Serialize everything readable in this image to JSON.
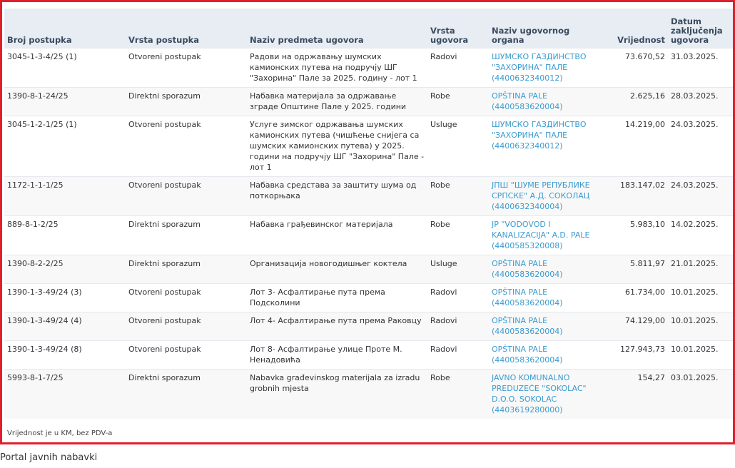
{
  "table": {
    "headers": {
      "broj": "Broj postupka",
      "vrsta_postupka": "Vrsta postupka",
      "naziv": "Naziv predmeta ugovora",
      "vrsta_ugovora": "Vrsta ugovora",
      "organ": "Naziv ugovornog organa",
      "vrijednost": "Vrijednost",
      "datum": "Datum zaključenja ugovora"
    },
    "rows": [
      {
        "broj": "3045-1-3-4/25 (1)",
        "vrsta_postupka": "Otvoreni postupak",
        "naziv": "Радови на одржавању шумских камионских путева на подручју ШГ \"Захорина\" Пале за 2025. годину - лот 1",
        "vrsta_ugovora": "Radovi",
        "organ": "ШУМСКО ГАЗДИНСТВО \"ЗАХОРИНА\" ПАЛЕ (4400632340012)",
        "vrijednost": "73.670,52",
        "datum": "31.03.2025."
      },
      {
        "broj": "1390-8-1-24/25",
        "vrsta_postupka": "Direktni sporazum",
        "naziv": "Набавка материјала за одржавање зграде Општине Пале у 2025. години",
        "vrsta_ugovora": "Robe",
        "organ": "OPŠTINA PALE (4400583620004)",
        "vrijednost": "2.625,16",
        "datum": "28.03.2025."
      },
      {
        "broj": "3045-1-2-1/25 (1)",
        "vrsta_postupka": "Otvoreni postupak",
        "naziv": "Услуге зимског одржавања шумских камионских путева (чишћење снијега са шумских камионских путева) у 2025. години на подручју ШГ \"Захорина\" Пале - лот 1",
        "vrsta_ugovora": "Usluge",
        "organ": "ШУМСКО ГАЗДИНСТВО \"ЗАХОРИНА\" ПАЛЕ (4400632340012)",
        "vrijednost": "14.219,00",
        "datum": "24.03.2025."
      },
      {
        "broj": "1172-1-1-1/25",
        "vrsta_postupka": "Otvoreni postupak",
        "naziv": "Набавка средстава за заштиту шума од поткорњака",
        "vrsta_ugovora": "Robe",
        "organ": "ЈПШ \"ШУМЕ РЕПУБЛИКЕ СРПСКЕ\" А.Д. СОКОЛАЦ (4400632340004)",
        "vrijednost": "183.147,02",
        "datum": "24.03.2025."
      },
      {
        "broj": "889-8-1-2/25",
        "vrsta_postupka": "Direktni sporazum",
        "naziv": "Набавка грађевинског материјала",
        "vrsta_ugovora": "Robe",
        "organ": "JP \"VODOVOD I KANALIZACIJA\" A.D. PALE (4400585320008)",
        "vrijednost": "5.983,10",
        "datum": "14.02.2025."
      },
      {
        "broj": "1390-8-2-2/25",
        "vrsta_postupka": "Direktni sporazum",
        "naziv": "Организација новогодишњег коктела",
        "vrsta_ugovora": "Usluge",
        "organ": "OPŠTINA PALE (4400583620004)",
        "vrijednost": "5.811,97",
        "datum": "21.01.2025."
      },
      {
        "broj": "1390-1-3-49/24 (3)",
        "vrsta_postupka": "Otvoreni postupak",
        "naziv": "Лот 3- Асфалтирање пута према Подсколини",
        "vrsta_ugovora": "Radovi",
        "organ": "OPŠTINA PALE (4400583620004)",
        "vrijednost": "61.734,00",
        "datum": "10.01.2025."
      },
      {
        "broj": "1390-1-3-49/24 (4)",
        "vrsta_postupka": "Otvoreni postupak",
        "naziv": "Лот 4- Асфалтирање пута према Раковцу",
        "vrsta_ugovora": "Radovi",
        "organ": "OPŠTINA PALE (4400583620004)",
        "vrijednost": "74.129,00",
        "datum": "10.01.2025."
      },
      {
        "broj": "1390-1-3-49/24 (8)",
        "vrsta_postupka": "Otvoreni postupak",
        "naziv": "Лот 8- Асфалтирање улице Проте М. Ненадовића",
        "vrsta_ugovora": "Radovi",
        "organ": "OPŠTINA PALE (4400583620004)",
        "vrijednost": "127.943,73",
        "datum": "10.01.2025."
      },
      {
        "broj": "5993-8-1-7/25",
        "vrsta_postupka": "Direktni sporazum",
        "naziv": "Nabavka građevinskog materijala za izradu grobnih mjesta",
        "vrsta_ugovora": "Robe",
        "organ": "JAVNO KOMUNALNO PREDUZEĆE \"SOKOLAC\" D.O.O. SOKOLAC (4403619280000)",
        "vrijednost": "154,27",
        "datum": "03.01.2025."
      }
    ]
  },
  "note": "Vrijednost je u KM, bez PDV-a",
  "footer": "Portal javnih nabavki",
  "colors": {
    "frame": "#e01f2d",
    "link": "#3a9bd0",
    "header_bg": "#e7edf3"
  }
}
